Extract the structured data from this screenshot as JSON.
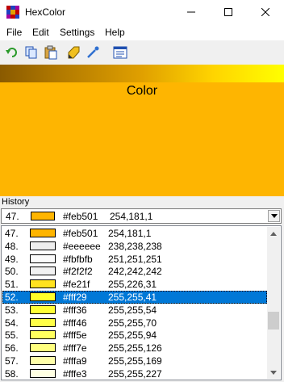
{
  "window": {
    "title": "HexColor"
  },
  "menu": [
    "File",
    "Edit",
    "Settings",
    "Help"
  ],
  "toolbar": {
    "icons": [
      "undo-icon",
      "copy-icon",
      "paste-icon",
      "marker-icon",
      "eyedropper-icon",
      "list-view-icon"
    ]
  },
  "swatch": {
    "label": "Color",
    "color": "#feb501"
  },
  "history": {
    "label": "History",
    "selected": {
      "num": "47.",
      "hex": "#feb501",
      "rgb": "254,181,1",
      "color": "#feb501"
    },
    "items": [
      {
        "num": "47.",
        "hex": "#feb501",
        "rgb": "254,181,1",
        "color": "#feb501"
      },
      {
        "num": "48.",
        "hex": "#eeeeee",
        "rgb": "238,238,238",
        "color": "#eeeeee"
      },
      {
        "num": "49.",
        "hex": "#fbfbfb",
        "rgb": "251,251,251",
        "color": "#fbfbfb"
      },
      {
        "num": "50.",
        "hex": "#f2f2f2",
        "rgb": "242,242,242",
        "color": "#f2f2f2"
      },
      {
        "num": "51.",
        "hex": "#fe21f",
        "rgb": "255,226,31",
        "color": "#ffe21f"
      },
      {
        "num": "52.",
        "hex": "#fff29",
        "rgb": "255,255,41",
        "color": "#ffff29"
      },
      {
        "num": "53.",
        "hex": "#fff36",
        "rgb": "255,255,54",
        "color": "#ffff36"
      },
      {
        "num": "54.",
        "hex": "#fff46",
        "rgb": "255,255,70",
        "color": "#ffff46"
      },
      {
        "num": "55.",
        "hex": "#fff5e",
        "rgb": "255,255,94",
        "color": "#ffff5e"
      },
      {
        "num": "56.",
        "hex": "#fff7e",
        "rgb": "255,255,126",
        "color": "#ffff7e"
      },
      {
        "num": "57.",
        "hex": "#fffa9",
        "rgb": "255,255,169",
        "color": "#ffffa9"
      },
      {
        "num": "58.",
        "hex": "#fffe3",
        "rgb": "255,255,227",
        "color": "#ffffe3"
      }
    ],
    "selected_index": 5
  }
}
